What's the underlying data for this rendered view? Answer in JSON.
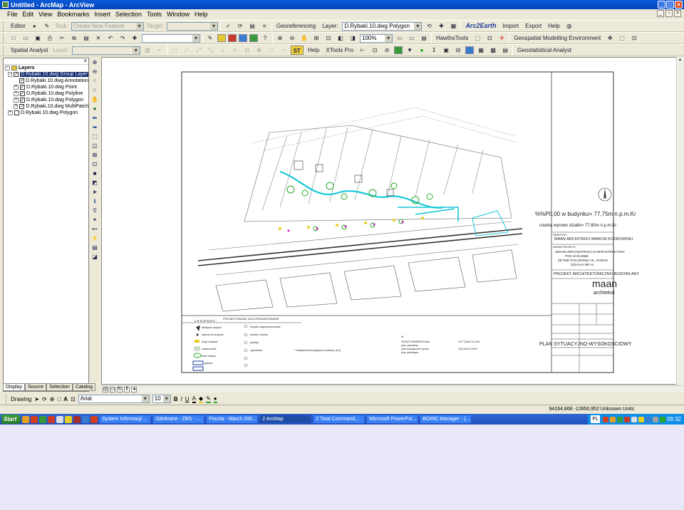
{
  "window": {
    "title": "Untitled - ArcMap - ArcView"
  },
  "menu": [
    "File",
    "Edit",
    "View",
    "Bookmarks",
    "Insert",
    "Selection",
    "Tools",
    "Window",
    "Help"
  ],
  "toolbar1": {
    "editor": "Editor",
    "task_label": "Task:",
    "task_value": "Create New Feature",
    "target_label": "Target:",
    "georef": "Georeferencing",
    "layer_label": "Layer:",
    "layer_value": "D.Rybaki.10.dwg Polygon",
    "arc2earth": "Arc2Earth",
    "import": "Import",
    "export": "Export",
    "help": "Help"
  },
  "toolbar2": {
    "zoom_value": "100%",
    "hawths": "HawthsTools",
    "gme": "Geospatial Modelling Environment"
  },
  "toolbar3": {
    "spatial": "Spatial Analyst",
    "layer_label": "Layer:",
    "stgw": "ST",
    "help": "Help",
    "xtools": "XTools Pro",
    "geostat": "Geostatistical Analyst"
  },
  "toc": {
    "root": "Layers",
    "group": "D.Rybaki.10.dwg Group Layer",
    "layers": [
      {
        "name": "D.Rybaki.10.dwg Annotation"
      },
      {
        "name": "D.Rybaki.10.dwg Point"
      },
      {
        "name": "D.Rybaki.10.dwg Polyline"
      },
      {
        "name": "D.Rybaki.10.dwg Polygon"
      },
      {
        "name": "D.Rybaki.10.dwg MultiPatch"
      }
    ],
    "other": "D.Rybaki.10.dwg Polygon",
    "tabs": [
      "Display",
      "Source",
      "Selection",
      "Catalog"
    ]
  },
  "drawing": {
    "label": "Drawing",
    "font": "Arial",
    "size": "10",
    "bold": "B",
    "italic": "I",
    "underline": "U"
  },
  "status": {
    "coords": "94164,868 -12850,952 Unknown Units"
  },
  "plan": {
    "rl_level": "%%P0,00 w budynku= 77,75m n.p.m.Kr",
    "rl_terrain": "rzedna wyrown dzialki= 77,60m n.p.m.Kr",
    "inwestor": "INWESTOR:",
    "author": "MAAN ARCHITEKCI MARCIN KOZIKOWSKI",
    "title_label": "NAZWA PROJEKTU",
    "project": [
      "ZMIANA REKONSTRUKCJI INFRASTRUKTURY",
      "POD ZAGLEBIE",
      "ZE RZE POLOZONEJ UL. RYBAKI",
      "DZIALKA NR xx"
    ],
    "firm": "PROJEKT ARCHITEKTONICZNO-BUDOWLANY",
    "maan": "maan",
    "maan_sub": "architekci",
    "plan_title": "PLAN SYTUACYJNO-WYSOKOSCIOWY",
    "legend_title": "L E G E N D A :",
    "legend_head": "PROJEKTOWANE ZAGOSPODAROWANIE",
    "legend": [
      "istniejace budynki",
      "wejscie do budynku",
      "drogi i miejsca",
      "nawierzchnia",
      "teren zielony",
      "granica"
    ],
    "legend_right": [
      "budynki zagospodarowania",
      "drzewa i krzewy",
      "parking",
      "ogrodzenie",
      "",
      ""
    ],
    "stats_title": "W",
    "stats": [
      "TERAZ POWIERZCHNIA:",
      "pow. zabudowy",
      "pow. biologicznie czynna",
      "pow. parkingow"
    ],
    "stats_vals": [
      "1077,00m2   21,13%",
      "",
      "102,00m2   2,00%"
    ],
    "stamp_rows": [
      "",
      "",
      "",
      ""
    ],
    "note": "* Uzasadnienie przyjetych rozwiazan (m2)"
  },
  "taskbar": {
    "start": "Start",
    "tasks": [
      "System Informacji ...",
      "Odebrane - ZBS - ...",
      "Poczta - March 200...",
      "2 ArcMap",
      "2 Total Command...",
      "Microsoft PowerPoi...",
      "BOINC Manager - (..."
    ],
    "lang": "PL",
    "clock": "09:32"
  }
}
